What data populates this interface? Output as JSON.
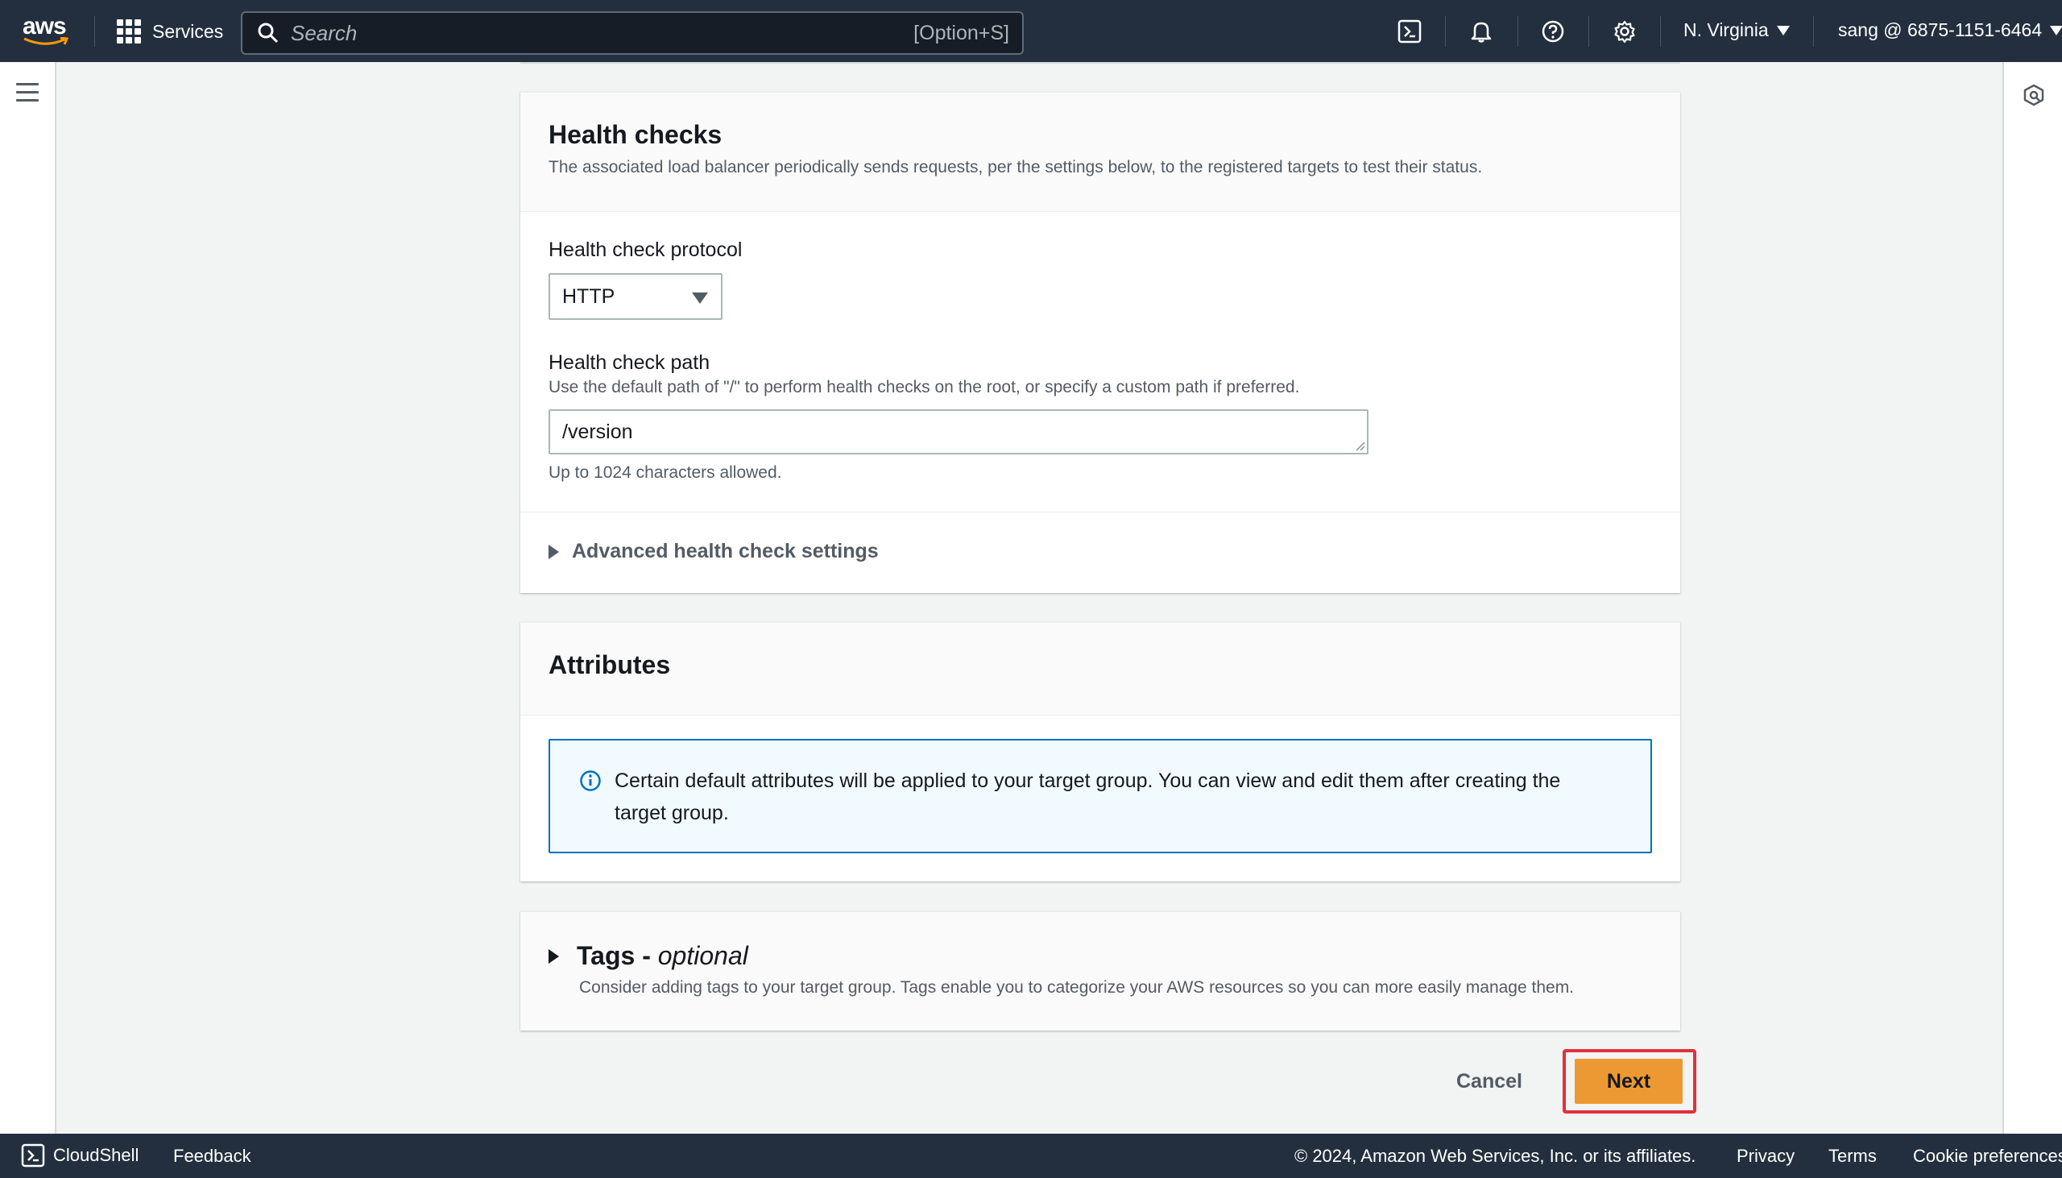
{
  "topnav": {
    "logo_text": "aws",
    "services_label": "Services",
    "search_placeholder": "Search",
    "search_shortcut": "[Option+S]",
    "region": "N. Virginia",
    "account": "sang @ 6875-1151-6464",
    "icons": [
      "cloudshell-icon",
      "bell-icon",
      "help-icon",
      "gear-icon"
    ]
  },
  "health_checks": {
    "title": "Health checks",
    "description": "The associated load balancer periodically sends requests, per the settings below, to the registered targets to test their status.",
    "protocol_label": "Health check protocol",
    "protocol_value": "HTTP",
    "path_label": "Health check path",
    "path_description": "Use the default path of \"/\" to perform health checks on the root, or specify a custom path if preferred.",
    "path_value": "/version",
    "path_constraint": "Up to 1024 characters allowed.",
    "advanced_label": "Advanced health check settings"
  },
  "attributes": {
    "title": "Attributes",
    "info_text": "Certain default attributes will be applied to your target group. You can view and edit them after creating the target group."
  },
  "tags": {
    "title": "Tags - ",
    "title_optional": "optional",
    "description": "Consider adding tags to your target group. Tags enable you to categorize your AWS resources so you can more easily manage them."
  },
  "actions": {
    "cancel_label": "Cancel",
    "next_label": "Next"
  },
  "footer": {
    "cloudshell": "CloudShell",
    "feedback": "Feedback",
    "copyright": "© 2024, Amazon Web Services, Inc. or its affiliates.",
    "privacy": "Privacy",
    "terms": "Terms",
    "cookies": "Cookie preferences"
  },
  "colors": {
    "nav_bg": "#232f3e",
    "primary_button": "#ec9933",
    "info_border": "#0073bb",
    "highlight": "#e0313c"
  }
}
